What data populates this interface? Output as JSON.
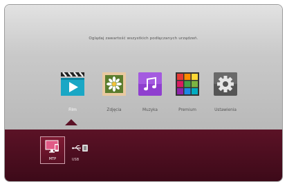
{
  "home": {
    "message": "Oglądaj zawartość wszystkich podłączanych urządzeń.",
    "menu": [
      {
        "label": "Film",
        "icon": "film-icon",
        "selected": true
      },
      {
        "label": "Zdjęcia",
        "icon": "photo-icon",
        "selected": false
      },
      {
        "label": "Muzyka",
        "icon": "music-icon",
        "selected": false
      },
      {
        "label": "Premium",
        "icon": "premium-icon",
        "selected": false
      },
      {
        "label": "Ustawienia",
        "icon": "settings-icon",
        "selected": false
      }
    ]
  },
  "devices": [
    {
      "label": "MTP",
      "icon": "mtp-device-icon",
      "selected": true
    },
    {
      "label": "USB",
      "icon": "usb-icon",
      "selected": false
    }
  ],
  "colors": {
    "accent": "#5b1226",
    "background_top": "#d5d5d5",
    "text": "#555555"
  }
}
